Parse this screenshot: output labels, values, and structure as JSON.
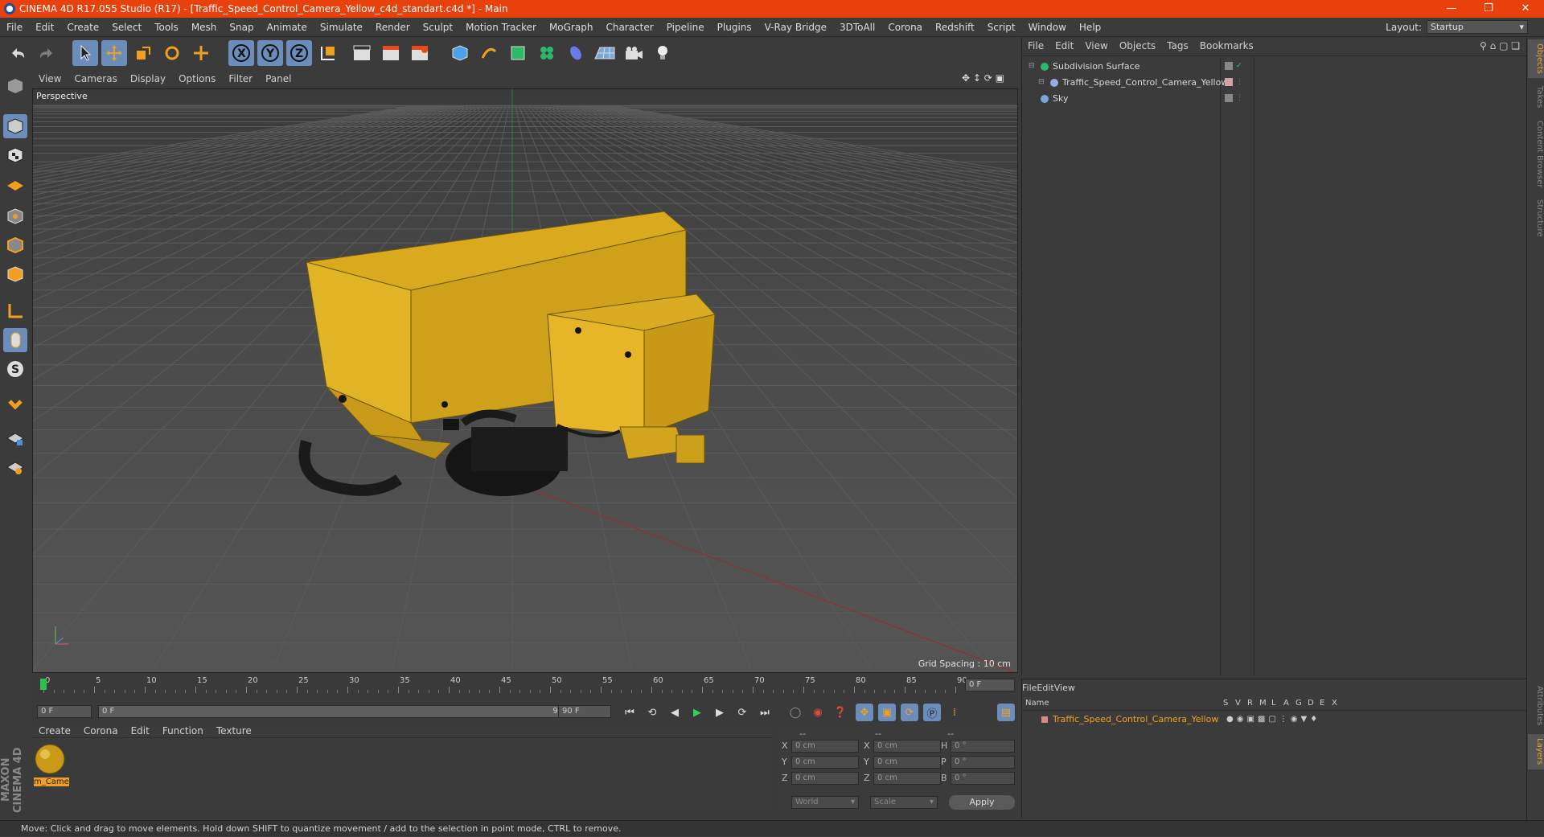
{
  "window": {
    "title": "CINEMA 4D R17.055 Studio (R17) - [Traffic_Speed_Control_Camera_Yellow_c4d_standart.c4d *] - Main"
  },
  "menubar": {
    "items": [
      "File",
      "Edit",
      "Create",
      "Select",
      "Tools",
      "Mesh",
      "Snap",
      "Animate",
      "Simulate",
      "Render",
      "Sculpt",
      "Motion Tracker",
      "MoGraph",
      "Character",
      "Pipeline",
      "Plugins",
      "V-Ray Bridge",
      "3DToAll",
      "Corona",
      "Redshift",
      "Script",
      "Window",
      "Help"
    ],
    "layout_label": "Layout:",
    "layout_value": "Startup"
  },
  "viewport": {
    "menu": [
      "View",
      "Cameras",
      "Display",
      "Options",
      "Filter",
      "Panel"
    ],
    "label": "Perspective",
    "grid_spacing": "Grid Spacing : 10 cm"
  },
  "timeline": {
    "ticks": [
      "0",
      "5",
      "10",
      "15",
      "20",
      "25",
      "30",
      "35",
      "40",
      "45",
      "50",
      "55",
      "60",
      "65",
      "70",
      "75",
      "80",
      "85",
      "90"
    ],
    "current_frame": "0 F",
    "start_field": "0 F",
    "range_start": "0 F",
    "range_end": "90 F",
    "end_field": "90 F"
  },
  "material_panel": {
    "menu": [
      "Create",
      "Corona",
      "Edit",
      "Function",
      "Texture"
    ],
    "material_name": "m_Came"
  },
  "coordinates": {
    "header": [
      "--",
      "--",
      "--"
    ],
    "rows": [
      {
        "axis": "X",
        "pos": "0 cm",
        "axis2": "X",
        "size": "0 cm",
        "rot_axis": "H",
        "rot": "0 °"
      },
      {
        "axis": "Y",
        "pos": "0 cm",
        "axis2": "Y",
        "size": "0 cm",
        "rot_axis": "P",
        "rot": "0 °"
      },
      {
        "axis": "Z",
        "pos": "0 cm",
        "axis2": "Z",
        "size": "0 cm",
        "rot_axis": "B",
        "rot": "0 °"
      }
    ],
    "mode1": "World",
    "mode2": "Scale",
    "apply": "Apply"
  },
  "object_manager": {
    "menu": [
      "File",
      "Edit",
      "View",
      "Objects",
      "Tags",
      "Bookmarks"
    ],
    "objects": [
      {
        "name": "Subdivision Surface",
        "indent": 0
      },
      {
        "name": "Traffic_Speed_Control_Camera_Yellow",
        "indent": 1
      },
      {
        "name": "Sky",
        "indent": 0
      }
    ]
  },
  "layer_manager": {
    "menu": [
      "File",
      "Edit",
      "View"
    ],
    "columns": [
      "Name",
      "S",
      "V",
      "R",
      "M",
      "L",
      "A",
      "G",
      "D",
      "E",
      "X"
    ],
    "row_name": "Traffic_Speed_Control_Camera_Yellow"
  },
  "right_tabs": [
    "Objects",
    "Takes",
    "Content Browser",
    "Structure"
  ],
  "right_tabs_bottom": [
    "Attributes",
    "Layers"
  ],
  "branding": "MAXON CINEMA 4D",
  "status": "Move: Click and drag to move elements. Hold down SHIFT to quantize movement / add to the selection in point mode, CTRL to remove.",
  "colors": {
    "title_bar": "#e8410b",
    "accent": "#e8a23a",
    "model_yellow": "#e0b020",
    "selected_blue": "#6a8dbb"
  }
}
